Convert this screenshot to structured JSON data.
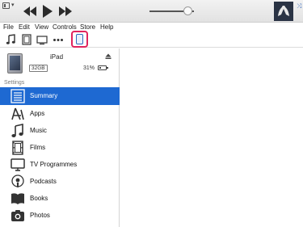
{
  "colors": {
    "accent": "#1e69d2",
    "highlight": "#e0245e"
  },
  "topbar": {
    "transport": [
      "rewind-icon",
      "play-icon",
      "fast-forward-icon"
    ],
    "volume_level": 0.85,
    "shuffle_glyph": "⤨"
  },
  "menubar": {
    "items": [
      "File",
      "Edit",
      "View",
      "Controls",
      "Store",
      "Help"
    ]
  },
  "toolbar": {
    "icons": [
      "music-note-icon",
      "film-icon",
      "tv-icon",
      "more-icon",
      "ipad-device-icon"
    ]
  },
  "device": {
    "name": "iPad",
    "capacity": "32GB",
    "battery_text": "31%",
    "battery_level": 0.31
  },
  "sidebar": {
    "section_label": "Settings",
    "items": [
      {
        "label": "Summary",
        "icon": "summary-icon",
        "active": true
      },
      {
        "label": "Apps",
        "icon": "apps-icon",
        "active": false
      },
      {
        "label": "Music",
        "icon": "music-icon",
        "active": false
      },
      {
        "label": "Films",
        "icon": "films-icon",
        "active": false
      },
      {
        "label": "TV Programmes",
        "icon": "tv-programmes-icon",
        "active": false
      },
      {
        "label": "Podcasts",
        "icon": "podcasts-icon",
        "active": false
      },
      {
        "label": "Books",
        "icon": "books-icon",
        "active": false
      },
      {
        "label": "Photos",
        "icon": "photos-icon",
        "active": false
      }
    ]
  }
}
